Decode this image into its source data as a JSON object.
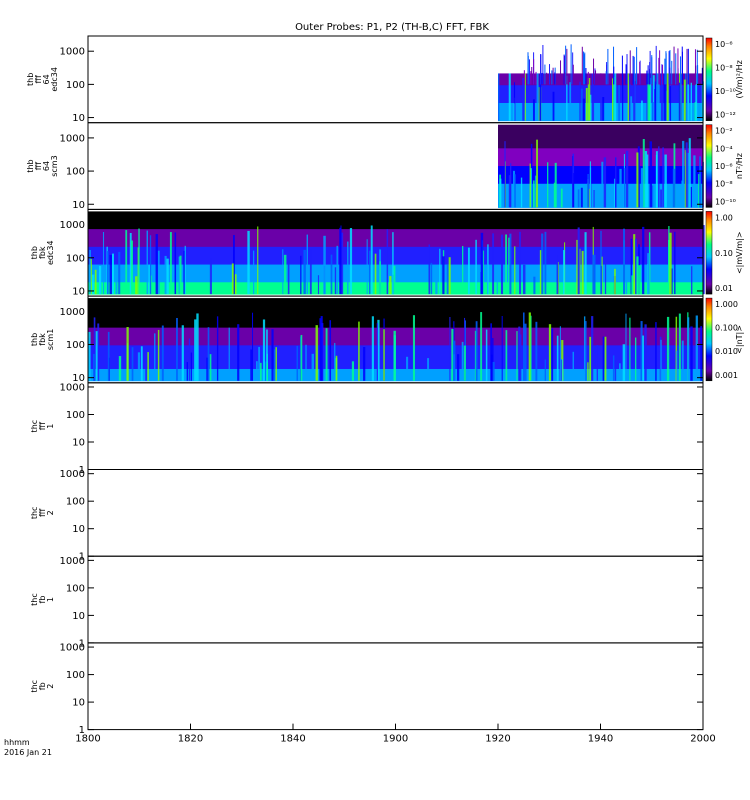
{
  "title": "Outer Probes: P1, P2 (TH-B,C) FFT, FBK",
  "footer": {
    "time_label": "hhmm",
    "date_label": "2016 Jan 21"
  },
  "chart_data": {
    "type": "heatmap",
    "x_ticks": [
      "1800",
      "1820",
      "1840",
      "1900",
      "1920",
      "1940",
      "2000"
    ],
    "panels": [
      {
        "id": "thb-fff-64-edc34",
        "label_lines": [
          "thb",
          "fff",
          "64",
          "edc34"
        ],
        "y_ticks": [
          "10",
          "100",
          "1000"
        ],
        "has_data": true,
        "data_start_hhmm": "1920",
        "colorbar": {
          "unit": "(V/m)²/Hz",
          "ticks": [
            "10⁻⁶",
            "10⁻⁸",
            "10⁻¹⁰",
            "10⁻¹²"
          ],
          "scale": "log"
        }
      },
      {
        "id": "thb-fff-64-scm3",
        "label_lines": [
          "thb",
          "fff",
          "64",
          "scm3"
        ],
        "y_ticks": [
          "10",
          "100",
          "1000"
        ],
        "has_data": true,
        "data_start_hhmm": "1920",
        "colorbar": {
          "unit": "nT²/Hz",
          "ticks": [
            "10⁻²",
            "10⁻⁴",
            "10⁻⁶",
            "10⁻⁸",
            "10⁻¹⁰"
          ],
          "scale": "log"
        }
      },
      {
        "id": "thb-fbk-edc34",
        "label_lines": [
          "thb",
          "fbk",
          "edc34"
        ],
        "y_ticks": [
          "10",
          "100",
          "1000"
        ],
        "has_data": true,
        "data_start_hhmm": "1800",
        "colorbar": {
          "unit": "<|mV/m|>",
          "ticks": [
            "1.00",
            "0.10",
            "0.01"
          ],
          "scale": "log"
        }
      },
      {
        "id": "thb-fbk-scm1",
        "label_lines": [
          "thb",
          "fbk",
          "scm1"
        ],
        "y_ticks": [
          "10",
          "100",
          "1000"
        ],
        "has_data": true,
        "data_start_hhmm": "1800",
        "colorbar": {
          "unit": "<|nT|>",
          "ticks": [
            "1.000",
            "0.100",
            "0.010",
            "0.001"
          ],
          "scale": "log"
        }
      },
      {
        "id": "thc-fff-1",
        "label_lines": [
          "thc",
          "fff",
          "1"
        ],
        "y_ticks": [
          "1",
          "10",
          "100",
          "1000"
        ],
        "has_data": false
      },
      {
        "id": "thc-fff-2",
        "label_lines": [
          "thc",
          "fff",
          "2"
        ],
        "y_ticks": [
          "1",
          "10",
          "100",
          "1000"
        ],
        "has_data": false
      },
      {
        "id": "thc-fb-1",
        "label_lines": [
          "thc",
          "fb",
          "1"
        ],
        "y_ticks": [
          "1",
          "10",
          "100",
          "1000"
        ],
        "has_data": false
      },
      {
        "id": "thc-fb-2",
        "label_lines": [
          "thc",
          "fb",
          "2"
        ],
        "y_ticks": [
          "1",
          "10",
          "100",
          "1000"
        ],
        "has_data": false
      }
    ]
  }
}
